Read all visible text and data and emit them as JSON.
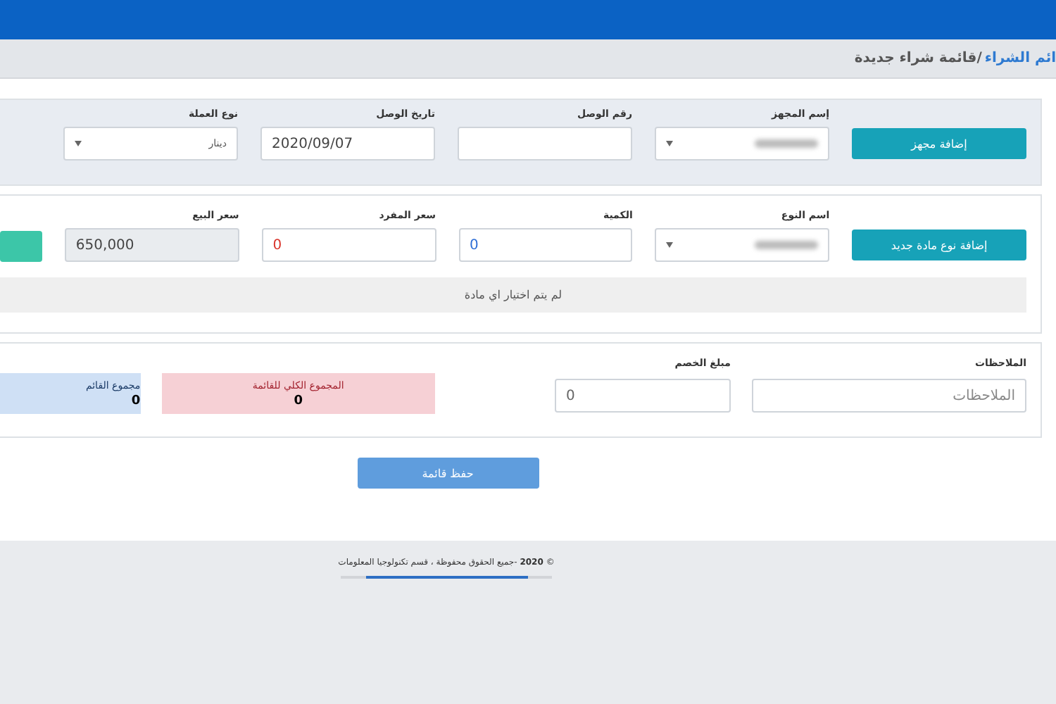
{
  "breadcrumb": {
    "parent": "ائم الشراء",
    "current": "/قائمة شراء جديدة"
  },
  "device_section": {
    "action": "إضافة مجهز",
    "fields": [
      {
        "kind": "select",
        "label": "إسم المجهز",
        "blurred": true
      },
      {
        "kind": "input",
        "label": "رقم الوصل",
        "disabled": false
      },
      {
        "kind": "input",
        "label": "تاريخ الوصل",
        "value": "2020/09/07",
        "color": "#444444",
        "disabled": false
      },
      {
        "kind": "select",
        "label": "نوع العملة",
        "value": "دينار",
        "blurred": false
      }
    ]
  },
  "item_section": {
    "action": "إضافة نوع مادة جديد",
    "fields": [
      {
        "kind": "select",
        "label": "اسم النوع",
        "blurred": true
      },
      {
        "kind": "input",
        "label": "الكمية",
        "value": "0",
        "color": "#2f6fd6",
        "disabled": false
      },
      {
        "kind": "input",
        "label": "سعر المفرد",
        "value": "0",
        "color": "#d9342b",
        "disabled": false
      },
      {
        "kind": "input",
        "label": "سعر البيع",
        "value": "650,000",
        "color": "#444444",
        "disabled": true
      }
    ],
    "empty_message": "لم يتم اختيار اي مادة"
  },
  "summary_section": {
    "notes": {
      "label": "الملاحظات",
      "placeholder": "الملاحظات"
    },
    "discount": {
      "label": "مبلغ الخصم",
      "value": "0"
    },
    "totals": [
      {
        "label": "المجموع الكلي للقائمة",
        "value": "0",
        "color": "#f6d0d5"
      },
      {
        "label": "مجموع القائم",
        "value": "0",
        "color": "#cfe0f5"
      }
    ]
  },
  "save_button": "حفظ قائمة",
  "footer": {
    "symbol": "©",
    "year": "2020",
    "text": "-جميع الحقوق محفوظة ، قسم تكنولوجيا المعلومات"
  }
}
